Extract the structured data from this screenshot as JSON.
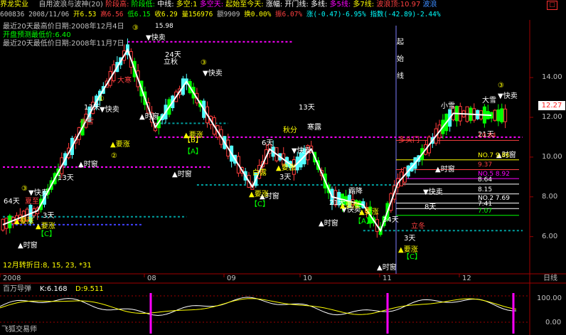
{
  "colors": {
    "up": "#ff3c3c",
    "down": "#54ffff",
    "green": "#00ff00",
    "yellow": "#ffff00",
    "magenta": "#ff00ff",
    "white": "#ffffff",
    "cyan": "#00ffff",
    "grid": "#800000"
  },
  "header": {
    "stock_name": "界龙实业",
    "indicator": "自用波浪与波神(20)",
    "items": [
      {
        "text": "阶段高:",
        "color": "#ff4040"
      },
      {
        "text": "阶段低:",
        "color": "#00ff00"
      },
      {
        "text": "中线:",
        "color": "#ffffff"
      },
      {
        "text": "多空:1",
        "color": "#ffff00"
      },
      {
        "text": "多空天:",
        "color": "#ff00ff"
      },
      {
        "text": "起始至今天:",
        "color": "#ffff00"
      },
      {
        "text": "涨幅:",
        "color": "#ffffff"
      },
      {
        "text": "开门线:",
        "color": "#ffffff"
      },
      {
        "text": "多线:",
        "color": "#ffffff"
      },
      {
        "text": "多5线:",
        "color": "#ff00ff"
      },
      {
        "text": "多7线:",
        "color": "#ffff00"
      },
      {
        "text": "波浪顶:10.97",
        "color": "#ff4040"
      },
      {
        "text": "波浪",
        "color": "#3c8cff"
      }
    ]
  },
  "quote": {
    "code": "600836",
    "date": "2008/11/06",
    "open": "开6.53",
    "high": "高6.56",
    "low": "低6.15",
    "close": "收6.29",
    "volume": "量156976",
    "amount": "额9909",
    "turnover": "换0.00%",
    "amplitude": "振6.07%",
    "change": "涨(-0.47)-6.95%",
    "index": "指数(-42.89)-2.44%"
  },
  "info_lines": [
    {
      "text": "最近20天最高价日期:2008年12月4日",
      "color": "#ffffff"
    },
    {
      "text": "开盘预测最低价:6.40",
      "color": "#00ff00"
    },
    {
      "text": "最近20天最低价日期:2008年11月7日",
      "color": "#ffffff"
    }
  ],
  "top_price_tag": "15.98",
  "price_axis": {
    "ticks": [
      {
        "value": 14.0,
        "label": "14.00"
      },
      {
        "value": 12.0,
        "label": "12.00"
      },
      {
        "value": 10.0,
        "label": "10.00"
      },
      {
        "value": 8.0,
        "label": "8.00"
      },
      {
        "value": 6.0,
        "label": "6.00"
      }
    ],
    "current": "12.27",
    "min": 4.2,
    "max": 16.9
  },
  "months": [
    "2008",
    "08",
    "09",
    "10",
    "11",
    "12"
  ],
  "period_label": "日线",
  "turn_label": "12月转折日:8, 15, 23, *31",
  "right_levels": [
    {
      "label": "10.84",
      "value": 10.84,
      "color": "#ff4040"
    },
    {
      "label": "NO.7 9.86",
      "value": 9.86,
      "color": "#ffff00"
    },
    {
      "label": "9.37",
      "value": 9.37,
      "color": "#ff4040"
    },
    {
      "label": "NO.5 8.92",
      "value": 8.92,
      "color": "#ff00ff"
    },
    {
      "label": "8.64",
      "value": 8.64,
      "color": "#ffffff"
    },
    {
      "label": "8.15",
      "value": 8.15,
      "color": "#ffffff"
    },
    {
      "label": "NO.2 7.69",
      "value": 7.69,
      "color": "#ffffff"
    },
    {
      "label": "7.41",
      "value": 7.41,
      "color": "#ffffff"
    },
    {
      "label": "7.07",
      "value": 7.07,
      "color": "#00ff00"
    }
  ],
  "annotations": [
    {
      "text": "▼快卖",
      "color": "#ffffff",
      "x": 205,
      "y": 20
    },
    {
      "text": "▼快卖",
      "color": "#ffffff",
      "x": 700,
      "y": 102
    },
    {
      "text": "▼快卖",
      "color": "#ffffff",
      "x": 140,
      "y": 121
    },
    {
      "text": "▼快卖",
      "color": "#ffffff",
      "x": 285,
      "y": 70
    },
    {
      "text": "▼快卖",
      "color": "#ffffff",
      "x": 40,
      "y": 238
    },
    {
      "text": "▼快卖",
      "color": "#ffffff",
      "x": 410,
      "y": 179
    },
    {
      "text": "▼快卖",
      "color": "#ffffff",
      "x": 595,
      "y": 237
    },
    {
      "text": "▼快卖",
      "color": "#ffffff",
      "x": 480,
      "y": 262
    },
    {
      "text": "▲时窗",
      "color": "#ffffff",
      "x": 196,
      "y": 131
    },
    {
      "text": "▲时窗",
      "color": "#ffffff",
      "x": 110,
      "y": 198
    },
    {
      "text": "▲时窗",
      "color": "#ffffff",
      "x": 242,
      "y": 212
    },
    {
      "text": "▲时窗",
      "color": "#ffffff",
      "x": 25,
      "y": 312
    },
    {
      "text": "▲时窗",
      "color": "#ffffff",
      "x": 365,
      "y": 243
    },
    {
      "text": "▲时窗",
      "color": "#ffffff",
      "x": 448,
      "y": 281
    },
    {
      "text": "▲时窗",
      "color": "#ffffff",
      "x": 530,
      "y": 343
    },
    {
      "text": "▲时窗",
      "color": "#ffffff",
      "x": 612,
      "y": 205
    },
    {
      "text": "▲时窗",
      "color": "#ffffff",
      "x": 698,
      "y": 185
    },
    {
      "text": "▲要涨",
      "color": "#ffff00",
      "x": 155,
      "y": 170
    },
    {
      "text": "▲要涨",
      "color": "#ffff00",
      "x": 258,
      "y": 157
    },
    {
      "text": "▲要涨",
      "color": "#ffff00",
      "x": 388,
      "y": 203
    },
    {
      "text": "▲要涨",
      "color": "#ffff00",
      "x": 350,
      "y": 240
    },
    {
      "text": "▲要涨",
      "color": "#ffff00",
      "x": 505,
      "y": 265
    },
    {
      "text": "▲要涨",
      "color": "#ffff00",
      "x": 50,
      "y": 285
    },
    {
      "text": "▲要涨",
      "color": "#ffff00",
      "x": 20,
      "y": 278
    },
    {
      "text": "▲要涨",
      "color": "#ffff00",
      "x": 478,
      "y": 256
    },
    {
      "text": "▲要涨",
      "color": "#ffff00",
      "x": 560,
      "y": 318
    },
    {
      "text": "24天",
      "color": "#ffffff",
      "x": 232,
      "y": 44
    },
    {
      "text": "13天",
      "color": "#ffffff",
      "x": 420,
      "y": 118
    },
    {
      "text": "13天",
      "color": "#ffffff",
      "x": 118,
      "y": 118
    },
    {
      "text": "13天",
      "color": "#ffffff",
      "x": 81,
      "y": 217
    },
    {
      "text": "21天",
      "color": "#ffffff",
      "x": 672,
      "y": 156
    },
    {
      "text": "8天",
      "color": "#ffffff",
      "x": 597,
      "y": 258
    },
    {
      "text": "3天",
      "color": "#ffffff",
      "x": 60,
      "y": 270
    },
    {
      "text": "3天",
      "color": "#ffffff",
      "x": 568,
      "y": 302
    },
    {
      "text": "34天",
      "color": "#ffffff",
      "x": 538,
      "y": 276
    },
    {
      "text": "21天",
      "color": "#ffffff",
      "x": 463,
      "y": 252
    },
    {
      "text": "3天",
      "color": "#ffffff",
      "x": 393,
      "y": 216
    },
    {
      "text": "64天",
      "color": "#ffffff",
      "x": 5,
      "y": 250
    },
    {
      "text": "6天",
      "color": "#ffffff",
      "x": 368,
      "y": 168
    },
    {
      "text": "大寒",
      "color": "#ff4040",
      "x": 165,
      "y": 80
    },
    {
      "text": "立秋",
      "color": "#ffffff",
      "x": 230,
      "y": 54
    },
    {
      "text": "白露",
      "color": "#ffff00",
      "x": 355,
      "y": 210
    },
    {
      "text": "秋分",
      "color": "#ffff00",
      "x": 398,
      "y": 150
    },
    {
      "text": "寒露",
      "color": "#ffffff",
      "x": 432,
      "y": 146
    },
    {
      "text": "霜降",
      "color": "#ffffff",
      "x": 490,
      "y": 236
    },
    {
      "text": "小雪",
      "color": "#ffffff",
      "x": 620,
      "y": 116
    },
    {
      "text": "大雪",
      "color": "#ffffff",
      "x": 678,
      "y": 108
    },
    {
      "text": "小雪",
      "color": "#ff4040",
      "x": 112,
      "y": 138
    },
    {
      "text": "立冬",
      "color": "#ff4040",
      "x": 578,
      "y": 285
    },
    {
      "text": "多头门",
      "color": "#ff4040",
      "x": 560,
      "y": 164
    },
    {
      "text": "夏至",
      "color": "#ff4040",
      "x": 35,
      "y": 250
    },
    {
      "text": "起",
      "color": "#ffffff",
      "x": 558,
      "y": 26
    },
    {
      "text": "始",
      "color": "#ffffff",
      "x": 558,
      "y": 50
    },
    {
      "text": "线",
      "color": "#ffffff",
      "x": 558,
      "y": 74
    },
    {
      "text": "【A】",
      "color": "#00ff00",
      "x": 258,
      "y": 180
    },
    {
      "text": "【A】",
      "color": "#00ff00",
      "x": 498,
      "y": 278
    },
    {
      "text": "【C】",
      "color": "#00ff00",
      "x": 352,
      "y": 254
    },
    {
      "text": "【C】",
      "color": "#00ff00",
      "x": 52,
      "y": 296
    },
    {
      "text": "【C】",
      "color": "#00ff00",
      "x": 566,
      "y": 328
    },
    {
      "text": "【B】",
      "color": "#ffff00",
      "x": 258,
      "y": 164
    },
    {
      "text": "①",
      "color": "#ffff00",
      "x": 138,
      "y": 106
    },
    {
      "text": "②",
      "color": "#ffff00",
      "x": 156,
      "y": 186
    },
    {
      "text": "③",
      "color": "#ffff00",
      "x": 186,
      "y": 6
    },
    {
      "text": "③",
      "color": "#ffff00",
      "x": 30,
      "y": 232
    },
    {
      "text": "③",
      "color": "#ffff00",
      "x": 282,
      "y": 55
    },
    {
      "text": "③",
      "color": "#ffff00",
      "x": 700,
      "y": 87
    }
  ],
  "chart_data": {
    "type": "candlestick",
    "ylim": [
      4.2,
      16.9
    ],
    "zigzag": [
      {
        "bar": 0,
        "price": 6.6
      },
      {
        "bar": 10,
        "price": 7.3
      },
      {
        "bar": 27,
        "price": 12.8
      },
      {
        "bar": 36,
        "price": 15.4
      },
      {
        "bar": 44,
        "price": 11.5
      },
      {
        "bar": 53,
        "price": 13.8
      },
      {
        "bar": 72,
        "price": 8.5
      },
      {
        "bar": 77,
        "price": 10.4
      },
      {
        "bar": 84,
        "price": 9.5
      },
      {
        "bar": 89,
        "price": 10.4
      },
      {
        "bar": 95,
        "price": 8.0
      },
      {
        "bar": 104,
        "price": 7.6
      },
      {
        "bar": 109,
        "price": 6.3
      },
      {
        "bar": 114,
        "price": 8.7
      },
      {
        "bar": 119,
        "price": 9.7
      },
      {
        "bar": 130,
        "price": 12.2
      },
      {
        "bar": 141,
        "price": 12.1
      }
    ],
    "levels": [
      {
        "value": 15.8,
        "color": "#ff00ff",
        "from_bar": 36,
        "to_bar": 84
      },
      {
        "value": 11.0,
        "color": "#ff00ff",
        "from_bar": 44,
        "to_bar": 150
      },
      {
        "value": 9.5,
        "color": "#ff00ff",
        "from_bar": 0,
        "to_bar": 60
      },
      {
        "value": 11.7,
        "color": "#00a0a0",
        "from_bar": 44,
        "to_bar": 65
      },
      {
        "value": 8.6,
        "color": "#00a0a0",
        "from_bar": 56,
        "to_bar": 115
      },
      {
        "value": 7.0,
        "color": "#00a0a0",
        "from_bar": 0,
        "to_bar": 53
      },
      {
        "value": 6.6,
        "color": "#4040ff",
        "from_bar": 0,
        "to_bar": 40
      },
      {
        "value": 6.3,
        "color": "#00a0a0",
        "from_bar": 104,
        "to_bar": 150
      }
    ],
    "oscillator": {
      "title": "百万导弹",
      "k_label": "K:6.168",
      "d_label": "D:9.511",
      "axis": [
        "100.00",
        "0.00"
      ],
      "ylim": [
        0,
        100
      ]
    }
  },
  "footer": {
    "brand": "飞狐交易师"
  }
}
